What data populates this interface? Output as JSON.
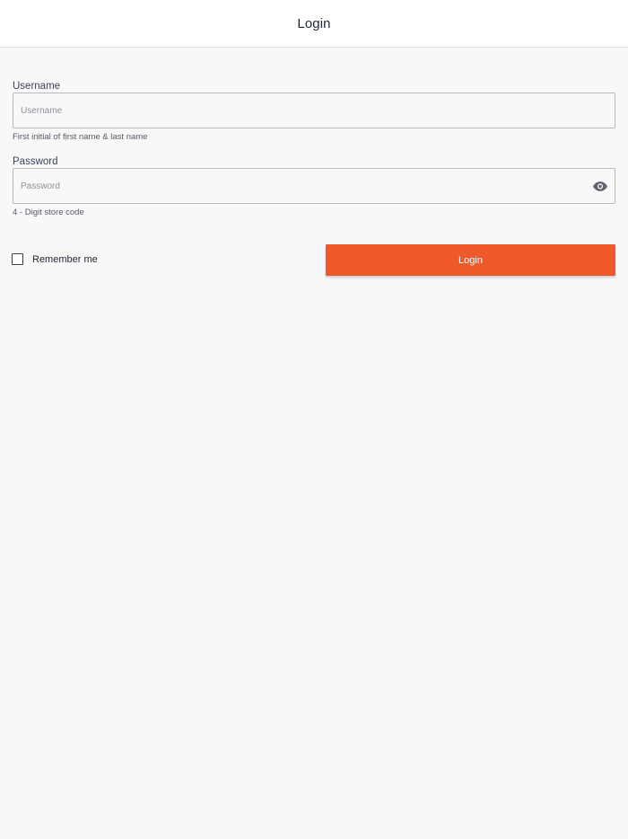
{
  "header": {
    "title": "Login"
  },
  "form": {
    "username": {
      "label": "Username",
      "placeholder": "Username",
      "value": "",
      "helper": "First initial of first name & last name"
    },
    "password": {
      "label": "Password",
      "placeholder": "Password",
      "value": "",
      "helper": "4 - Digit store code",
      "toggle_icon": "eye-icon"
    },
    "remember": {
      "label": "Remember me",
      "checked": false
    },
    "submit_label": "Login"
  },
  "colors": {
    "accent": "#f05a2b",
    "background": "#f8f8f9",
    "header_bg": "#ffffff"
  }
}
